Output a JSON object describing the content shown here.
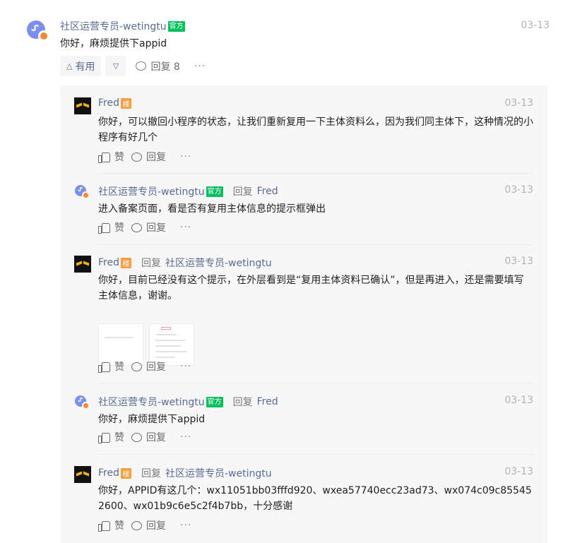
{
  "main": {
    "author": "社区运营专员-wetingtu",
    "official_tag": "官方",
    "date": "03-13",
    "text": "你好，麻烦提供下appid",
    "useful_label": "有用",
    "useful_icon": "triangle-up-icon",
    "down_icon": "triangle-down-icon",
    "reply_label": "回复 8",
    "more": "···"
  },
  "labels": {
    "like": "赞",
    "reply": "回复",
    "reply_to": "回复",
    "more": "···",
    "floor_tag": "楼",
    "official_tag": "官方"
  },
  "replies": [
    {
      "author": "Fred",
      "date": "03-13",
      "text": "你好，可以撤回小程序的状态，让我们重新复用一下主体资料么，因为我们同主体下，这种情况的小程序有好几个"
    },
    {
      "author": "社区运营专员-wetingtu",
      "reply_to": "Fred",
      "date": "03-13",
      "text": "进入备案页面，看是否有复用主体信息的提示框弹出"
    },
    {
      "author": "Fred",
      "reply_to": "社区运营专员-wetingtu",
      "date": "03-13",
      "text": "你好，目前已经没有这个提示，在外层看到是“复用主体资料已确认”，但是再进入，还是需要填写主体信息，谢谢。"
    },
    {
      "author": "社区运营专员-wetingtu",
      "reply_to": "Fred",
      "date": "03-13",
      "text": "你好，麻烦提供下appid"
    },
    {
      "author": "Fred",
      "reply_to": "社区运营专员-wetingtu",
      "date": "03-13",
      "text": "你好，APPID有这几个：wx11051bb03fffd920、wxea57740ecc23ad73、wx074c09c855452600、wx01b9c6e5c2f4b7bb，十分感谢"
    }
  ]
}
